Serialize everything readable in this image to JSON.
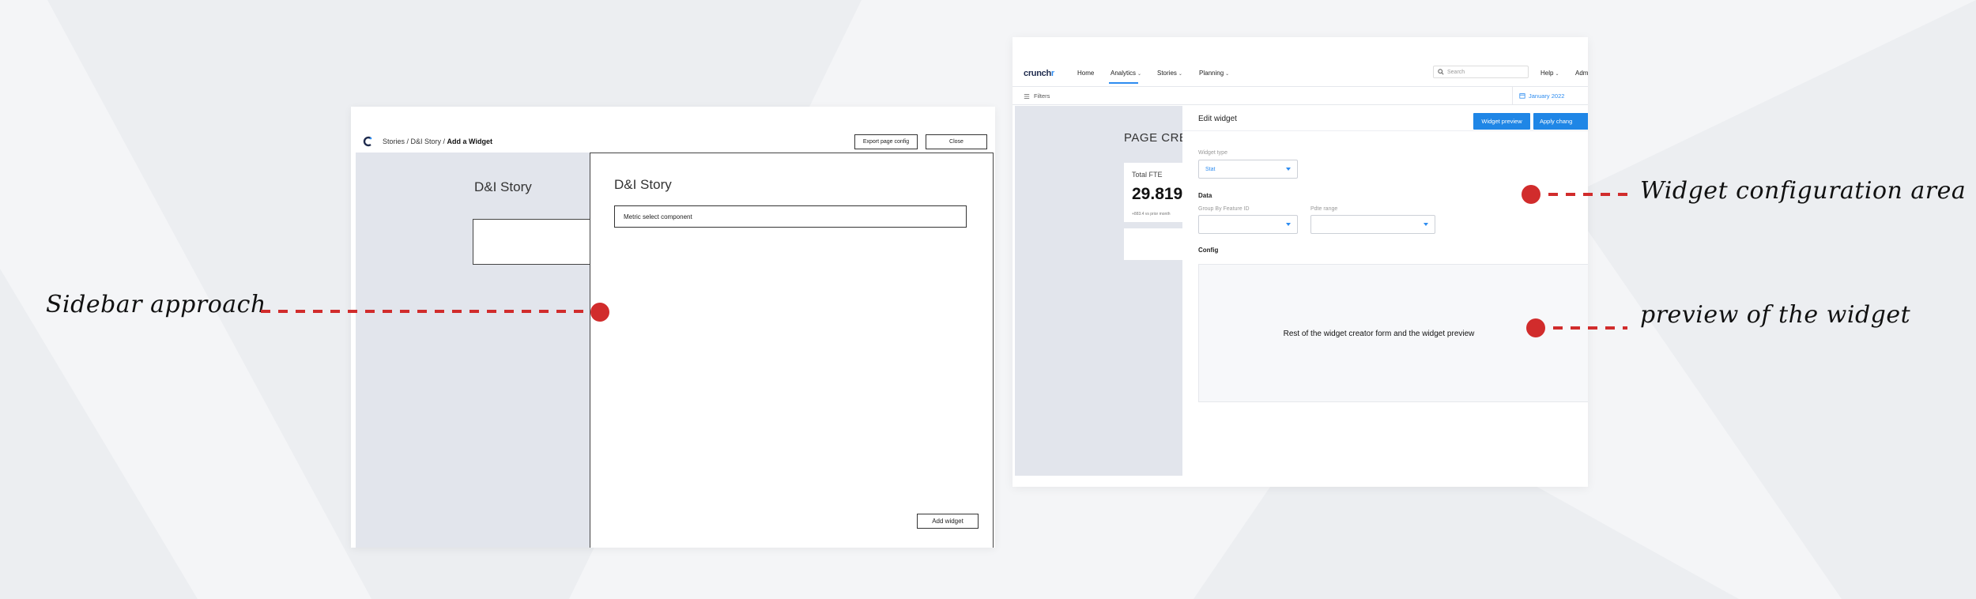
{
  "left_mockup": {
    "breadcrumb_path": "Stories / D&I Story / ",
    "breadcrumb_current": "Add a Widget",
    "export_label": "Export page config",
    "close_label": "Close",
    "canvas_title": "D&I Story",
    "sidebar_title": "D&I Story",
    "metric_select_label": "Metric select component",
    "add_widget_label": "Add widget"
  },
  "right_mockup": {
    "logo_prefix": "crunch",
    "logo_suffix": "r",
    "nav": [
      {
        "label": "Home"
      },
      {
        "label": "Analytics"
      },
      {
        "label": "Stories"
      },
      {
        "label": "Planning"
      }
    ],
    "active_nav": "Analytics",
    "search_placeholder": "Search",
    "help_label": "Help",
    "admin_label": "Adm",
    "filters_label": "Filters",
    "date_label": "January 2022",
    "page_title": "PAGE CREA",
    "kpi": {
      "label": "Total FTE",
      "value": "29.819",
      "sub": "+883.4 vs prior month"
    },
    "panel": {
      "title": "Edit widget",
      "preview_button": "Widget preview",
      "apply_button": "Apply chang",
      "widget_type_label": "Widget type",
      "widget_type_value": "Stat",
      "data_section": "Data",
      "group_by_label": "Group By Feature ID",
      "pdte_range_label": "Pdte range",
      "config_section": "Config",
      "config_placeholder": "Rest of the widget creator form and the widget preview"
    }
  },
  "annotations": {
    "sidebar": "Sidebar approach",
    "config_area": "Widget configuration area",
    "preview": "preview of the widget"
  },
  "colors": {
    "accent": "#d12c2c",
    "brand_blue": "#1f86e6",
    "canvas_grey": "#e2e5ec"
  }
}
